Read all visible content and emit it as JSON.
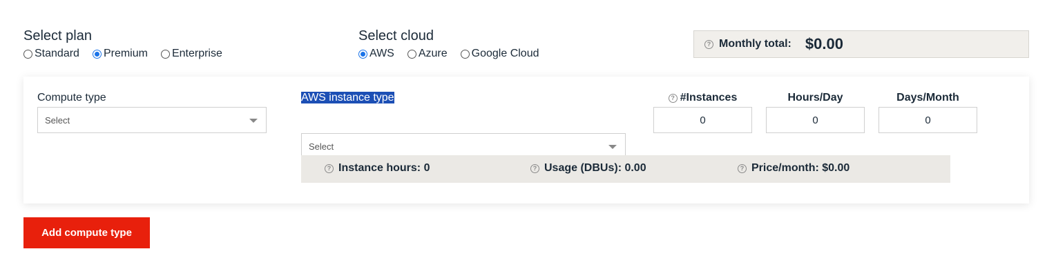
{
  "plan": {
    "title": "Select plan",
    "options": [
      "Standard",
      "Premium",
      "Enterprise"
    ],
    "selected": "Premium"
  },
  "cloud": {
    "title": "Select cloud",
    "options": [
      "AWS",
      "Azure",
      "Google Cloud"
    ],
    "selected": "AWS"
  },
  "monthly_total": {
    "label": "Monthly total:",
    "value": "$0.00"
  },
  "compute": {
    "compute_type_label": "Compute type",
    "compute_type_placeholder": "Select",
    "instance_type_label": "AWS instance type",
    "instance_type_placeholder": "Select",
    "instances_label": "#Instances",
    "instances_value": "0",
    "hours_label": "Hours/Day",
    "hours_value": "0",
    "days_label": "Days/Month",
    "days_value": "0"
  },
  "summary": {
    "instance_hours": "Instance hours: 0",
    "usage": "Usage (DBUs): 0.00",
    "price": "Price/month: $0.00"
  },
  "actions": {
    "add_compute_label": "Add compute type"
  },
  "icons": {
    "help": "help-circle-icon"
  },
  "colors": {
    "accent": "#e8200c",
    "radio_selected": "#1a73e8",
    "summary_bg": "#ebe9e5",
    "highlight": "#1c4fb5"
  }
}
